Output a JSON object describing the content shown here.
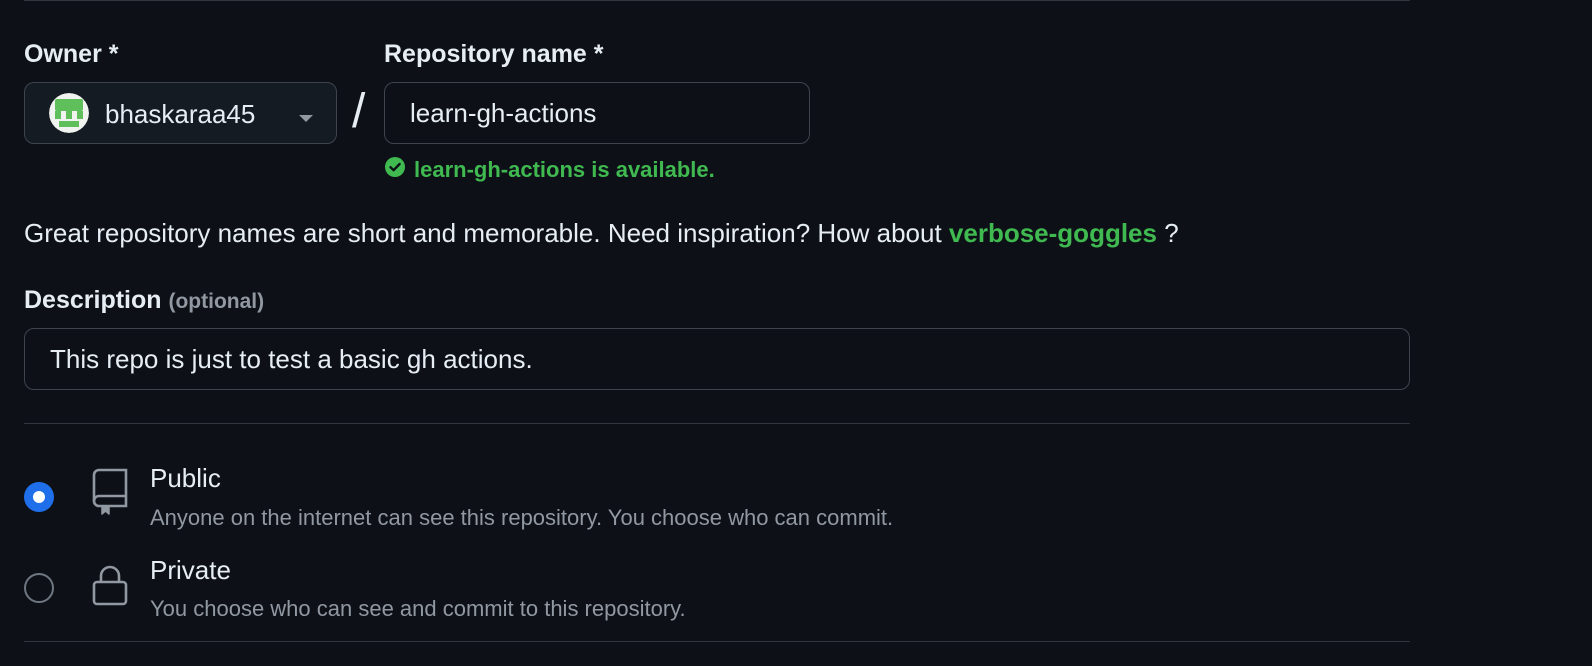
{
  "owner": {
    "label": "Owner *",
    "selected": "bhaskaraa45"
  },
  "separator": "/",
  "repository": {
    "label": "Repository name *",
    "value": "learn-gh-actions",
    "availability": "learn-gh-actions is available."
  },
  "hint": {
    "prefix": "Great repository names are short and memorable. Need inspiration? How about ",
    "suggestion": "verbose-goggles",
    "suffix": " ?"
  },
  "description": {
    "label": "Description",
    "optional": "(optional)",
    "value": "This repo is just to test a basic gh actions."
  },
  "visibility": {
    "options": [
      {
        "title": "Public",
        "description": "Anyone on the internet can see this repository. You choose who can commit.",
        "icon": "repo-icon",
        "checked": true
      },
      {
        "title": "Private",
        "description": "You choose who can see and commit to this repository.",
        "icon": "lock-icon",
        "checked": false
      }
    ]
  },
  "colors": {
    "background": "#0d1117",
    "success": "#3fb950",
    "accent": "#1f6feb",
    "muted": "#9198a1",
    "border": "#3d444d"
  }
}
